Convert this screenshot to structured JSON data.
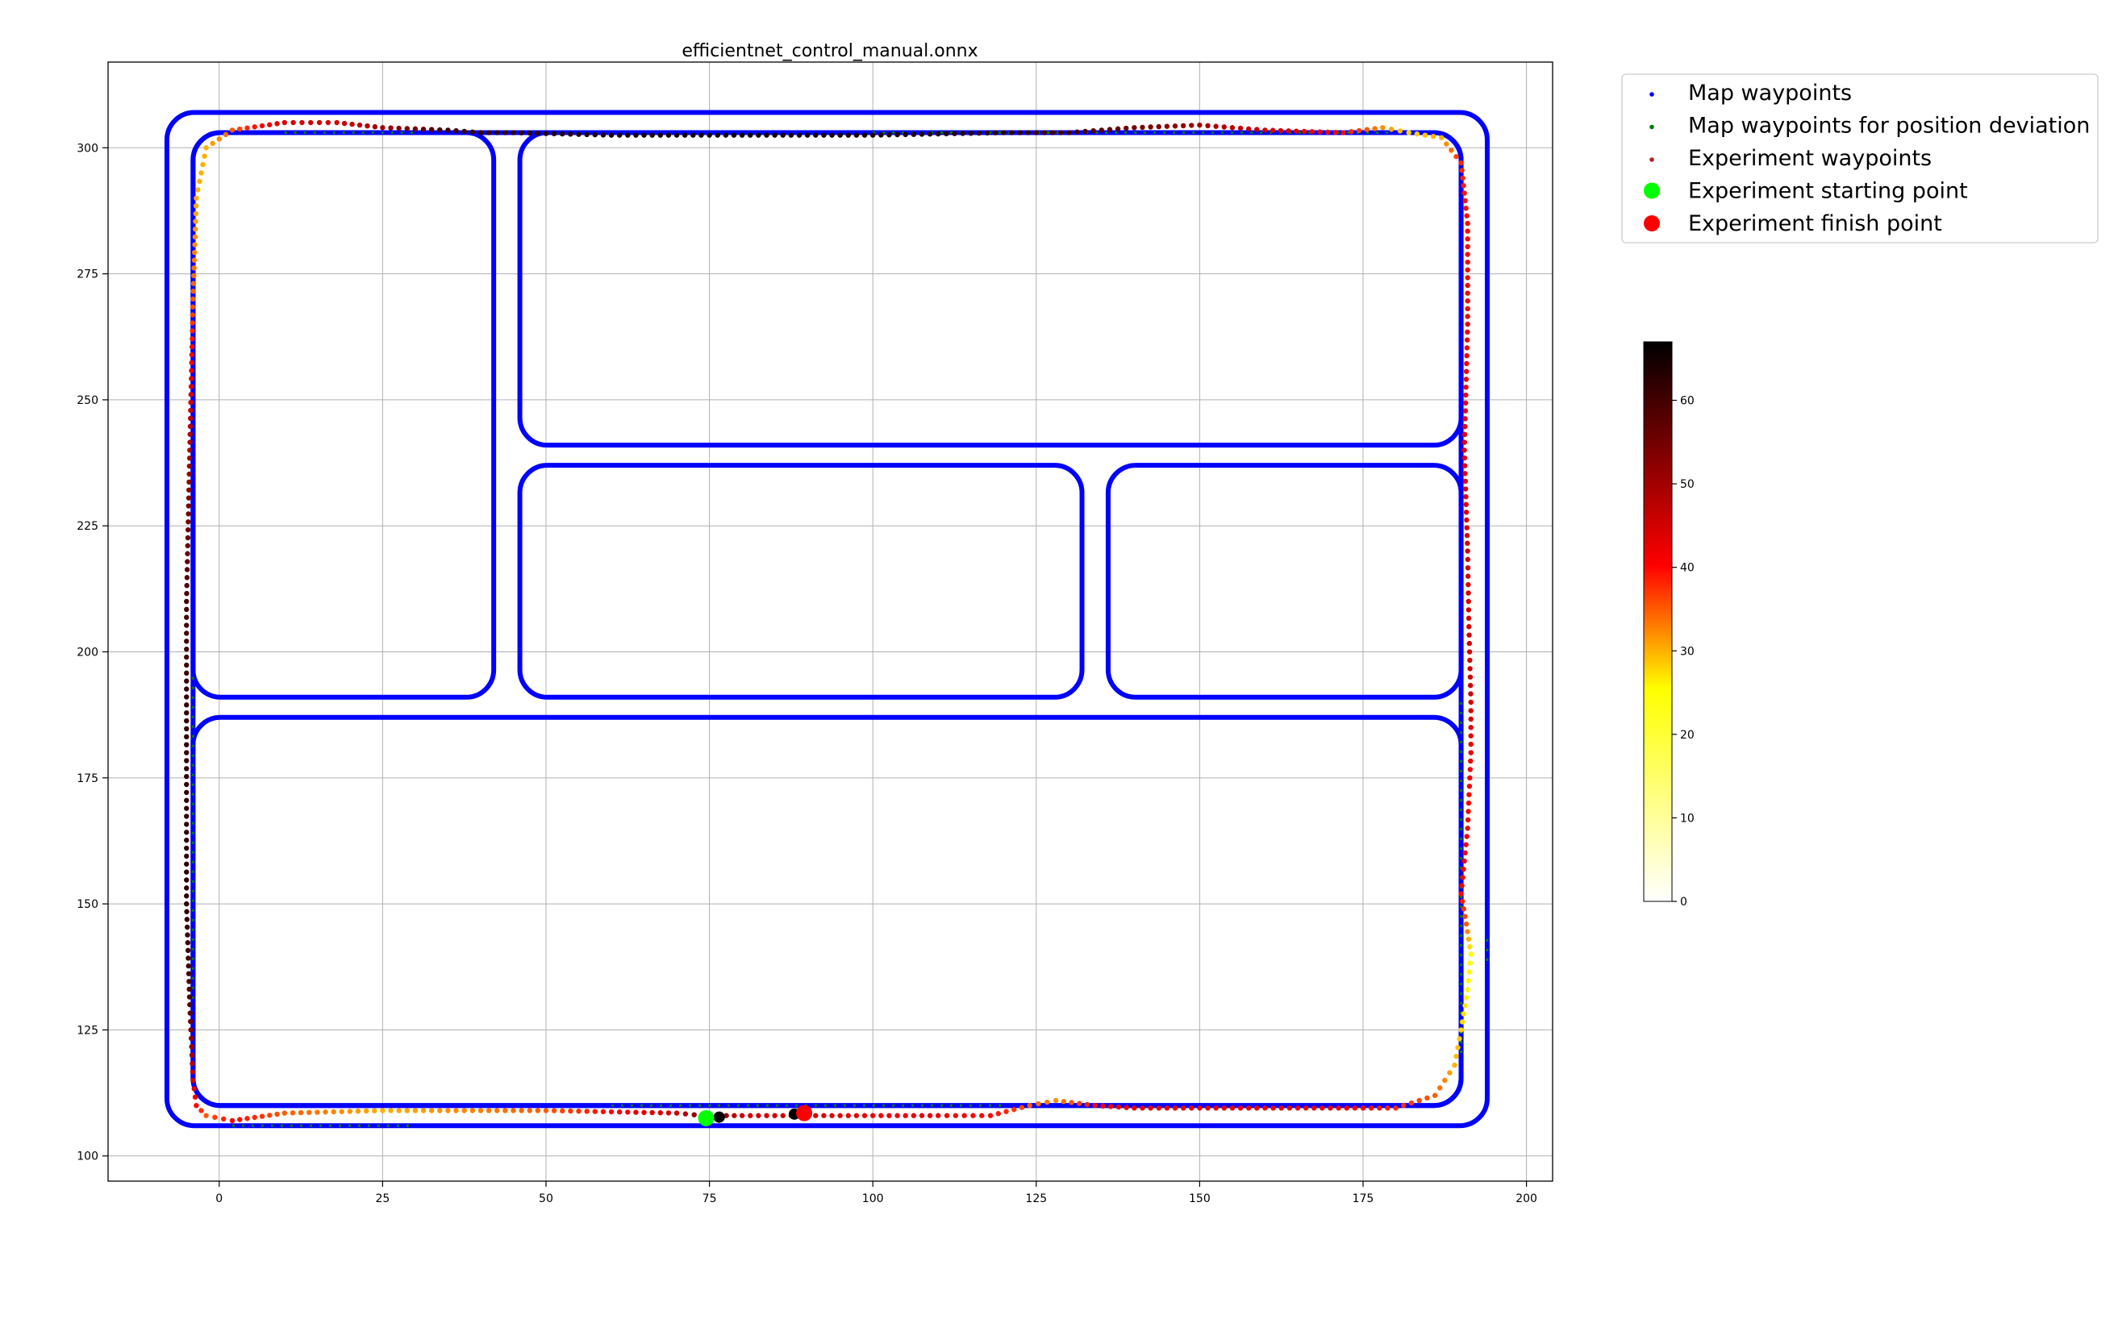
{
  "chart_data": {
    "type": "scatter",
    "title": "efficientnet_control_manual.onnx",
    "xlabel": "",
    "ylabel": "",
    "xlim": [
      -17,
      204
    ],
    "ylim": [
      95,
      317
    ],
    "x_ticks": [
      0,
      25,
      50,
      75,
      100,
      125,
      150,
      175,
      200
    ],
    "y_ticks": [
      100,
      125,
      150,
      175,
      200,
      225,
      250,
      275,
      300
    ],
    "grid": true,
    "legend_position": "outside-top-right",
    "legend": [
      {
        "label": "Map waypoints",
        "marker": "small-dot",
        "color": "#0000ff"
      },
      {
        "label": "Map waypoints for position deviation",
        "marker": "small-dot",
        "color": "#008000"
      },
      {
        "label": "Experiment waypoints",
        "marker": "small-dot",
        "color": "#b22222"
      },
      {
        "label": "Experiment starting point",
        "marker": "large-dot",
        "color": "#00ff00"
      },
      {
        "label": "Experiment finish point",
        "marker": "large-dot",
        "color": "#ff0000"
      }
    ],
    "colorbar": {
      "min": 0,
      "max": 67,
      "ticks": [
        0,
        10,
        20,
        30,
        40,
        50,
        60
      ],
      "colormap": "hot_r",
      "colormap_stops": [
        "#ffffff",
        "#ffff00",
        "#ff0000",
        "#000000"
      ]
    },
    "map_roads": [
      {
        "points": [
          [
            -8,
            106
          ],
          [
            194,
            106
          ],
          [
            194,
            307
          ],
          [
            -8,
            307
          ]
        ],
        "closed": true
      },
      {
        "points": [
          [
            -4,
            110
          ],
          [
            190,
            110
          ],
          [
            190,
            303
          ],
          [
            -4,
            303
          ]
        ],
        "closed": true
      },
      {
        "points": [
          [
            -4,
            191
          ],
          [
            42,
            191
          ],
          [
            42,
            303
          ],
          [
            -4,
            303
          ]
        ],
        "closed": true
      },
      {
        "points": [
          [
            46,
            241
          ],
          [
            190,
            241
          ],
          [
            190,
            303
          ],
          [
            46,
            303
          ]
        ],
        "closed": true
      },
      {
        "points": [
          [
            46,
            191
          ],
          [
            132,
            191
          ],
          [
            132,
            237
          ],
          [
            46,
            237
          ]
        ],
        "closed": true
      },
      {
        "points": [
          [
            136,
            191
          ],
          [
            190,
            191
          ],
          [
            190,
            237
          ],
          [
            136,
            237
          ]
        ],
        "closed": true
      },
      {
        "points": [
          [
            -4,
            110
          ],
          [
            190,
            110
          ],
          [
            190,
            187
          ],
          [
            -4,
            187
          ]
        ],
        "closed": true
      }
    ],
    "deviation_waypoints": [
      [
        [
          2,
          106
        ],
        [
          30,
          106
        ]
      ],
      [
        [
          60,
          110
        ],
        [
          120,
          110
        ]
      ],
      [
        [
          190,
          190
        ],
        [
          190,
          120
        ]
      ],
      [
        [
          194,
          143
        ],
        [
          194,
          138
        ]
      ],
      [
        [
          -4,
          195
        ],
        [
          -4,
          130
        ]
      ],
      [
        [
          10,
          303
        ],
        [
          30,
          303
        ]
      ],
      [
        [
          100,
          303
        ],
        [
          180,
          303
        ]
      ]
    ],
    "experiment_path": {
      "x": [
        74,
        80,
        90,
        100,
        110,
        118,
        124,
        128,
        134,
        140,
        150,
        160,
        170,
        180,
        186,
        189,
        190,
        191,
        191.5,
        190.8,
        190,
        191,
        191.5,
        191.5,
        191.2,
        191,
        190.5,
        191,
        191,
        190,
        187,
        182,
        178,
        172,
        160,
        150,
        140,
        130,
        120,
        100,
        80,
        60,
        45,
        40,
        35,
        25,
        18,
        10,
        2,
        -2,
        -3.5,
        -4,
        -4.5,
        -5,
        -5,
        -5,
        -4.5,
        -4,
        -3.5,
        -2,
        2,
        10,
        25,
        50,
        70,
        74
      ],
      "y": [
        108,
        108,
        108,
        108,
        108,
        108,
        110,
        111,
        110,
        109.5,
        109.5,
        109.5,
        109.5,
        109.5,
        112,
        118,
        125,
        133,
        140,
        146,
        152,
        165,
        180,
        190,
        205,
        220,
        240,
        265,
        285,
        297,
        302,
        303,
        304,
        303,
        303.5,
        304.5,
        304,
        303,
        303,
        302.5,
        302.5,
        302.5,
        303,
        303,
        303.5,
        304,
        305,
        305,
        303.5,
        300,
        290,
        270,
        240,
        210,
        180,
        150,
        130,
        115,
        110,
        108,
        107,
        108.5,
        109,
        109,
        108.5,
        108
      ],
      "speed": [
        60,
        45,
        45,
        42,
        42,
        40,
        35,
        32,
        40,
        42,
        42,
        42,
        42,
        38,
        35,
        30,
        28,
        26,
        25,
        35,
        40,
        42,
        42,
        45,
        45,
        45,
        42,
        42,
        40,
        38,
        30,
        28,
        32,
        40,
        45,
        50,
        55,
        60,
        62,
        64,
        65,
        64,
        62,
        62,
        60,
        50,
        45,
        45,
        35,
        30,
        30,
        35,
        50,
        60,
        62,
        62,
        58,
        45,
        40,
        35,
        40,
        35,
        30,
        35,
        45,
        55
      ]
    },
    "start_point": {
      "x": 74.5,
      "y": 107.5
    },
    "finish_point": {
      "x": 89.5,
      "y": 108.5
    },
    "black_markers": [
      {
        "x": 76.5,
        "y": 107.7
      },
      {
        "x": 88,
        "y": 108.3
      }
    ]
  }
}
